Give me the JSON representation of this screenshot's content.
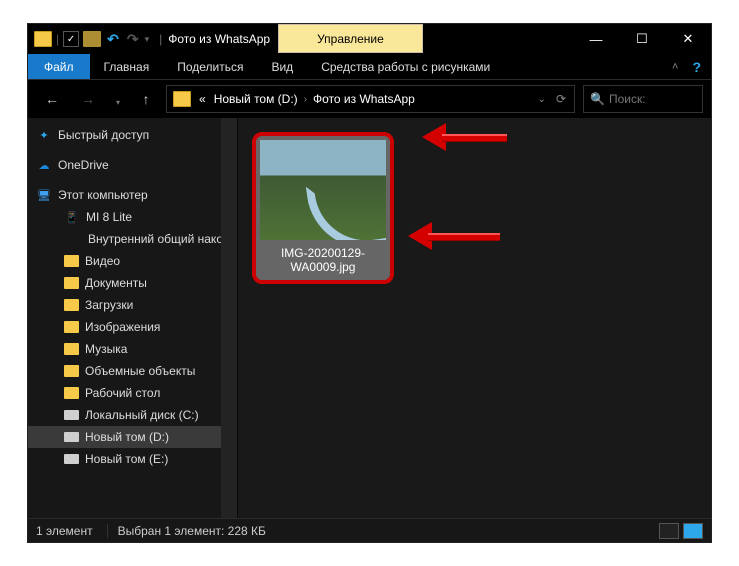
{
  "titlebar": {
    "title": "Фото из WhatsApp",
    "context_tab": "Управление"
  },
  "ribbon": {
    "file": "Файл",
    "home": "Главная",
    "share": "Поделиться",
    "view": "Вид",
    "picture_tools": "Средства работы с рисунками"
  },
  "breadcrumb": {
    "prefix": "«",
    "part1": "Новый том (D:)",
    "part2": "Фото из WhatsApp"
  },
  "search": {
    "placeholder": "Поиск:"
  },
  "nav": {
    "quick_access": "Быстрый доступ",
    "onedrive": "OneDrive",
    "this_pc": "Этот компьютер",
    "mi8": "MI 8 Lite",
    "internal": "Внутренний общий накопитель",
    "videos": "Видео",
    "documents": "Документы",
    "downloads": "Загрузки",
    "pictures": "Изображения",
    "music": "Музыка",
    "objects3d": "Объемные объекты",
    "desktop": "Рабочий стол",
    "local_c": "Локальный диск (C:)",
    "local_d": "Новый том (D:)",
    "local_e": "Новый том (E:)"
  },
  "file": {
    "name": "IMG-20200129-WA0009.jpg"
  },
  "status": {
    "count": "1 элемент",
    "selection": "Выбран 1 элемент: 228 КБ"
  }
}
